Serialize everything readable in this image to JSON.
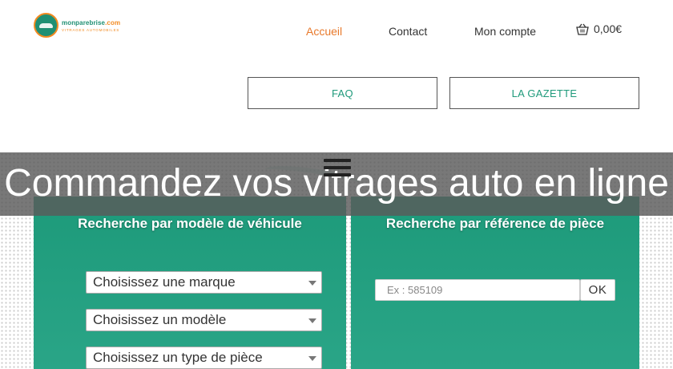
{
  "brand": {
    "name": "monparebrise",
    "name_suffix": ".com",
    "tagline": "VITRAGES AUTOMOBILES",
    "primary_color": "#1f8f73",
    "accent_color": "#f28a21"
  },
  "nav": {
    "items": [
      {
        "label": "Accueil",
        "active": true
      },
      {
        "label": "Contact",
        "active": false
      },
      {
        "label": "Mon compte",
        "active": false
      }
    ],
    "cart_icon": "basket-icon",
    "cart_total": "0,00€"
  },
  "subnav": {
    "faq_label": "FAQ",
    "gazette_label": "LA GAZETTE"
  },
  "hero": {
    "title": "Commandez vos vitrages auto en ligne",
    "menu_icon": "hamburger-menu-icon"
  },
  "search_model": {
    "title": "Recherche par modèle de véhicule",
    "selects": [
      {
        "value": "Choisissez une marque"
      },
      {
        "value": "Choisissez un modèle"
      },
      {
        "value": "Choisissez un type de pièce"
      }
    ]
  },
  "search_reference": {
    "title": "Recherche par référence de pièce",
    "input_placeholder": "Ex : 585109",
    "submit_label": "OK"
  }
}
